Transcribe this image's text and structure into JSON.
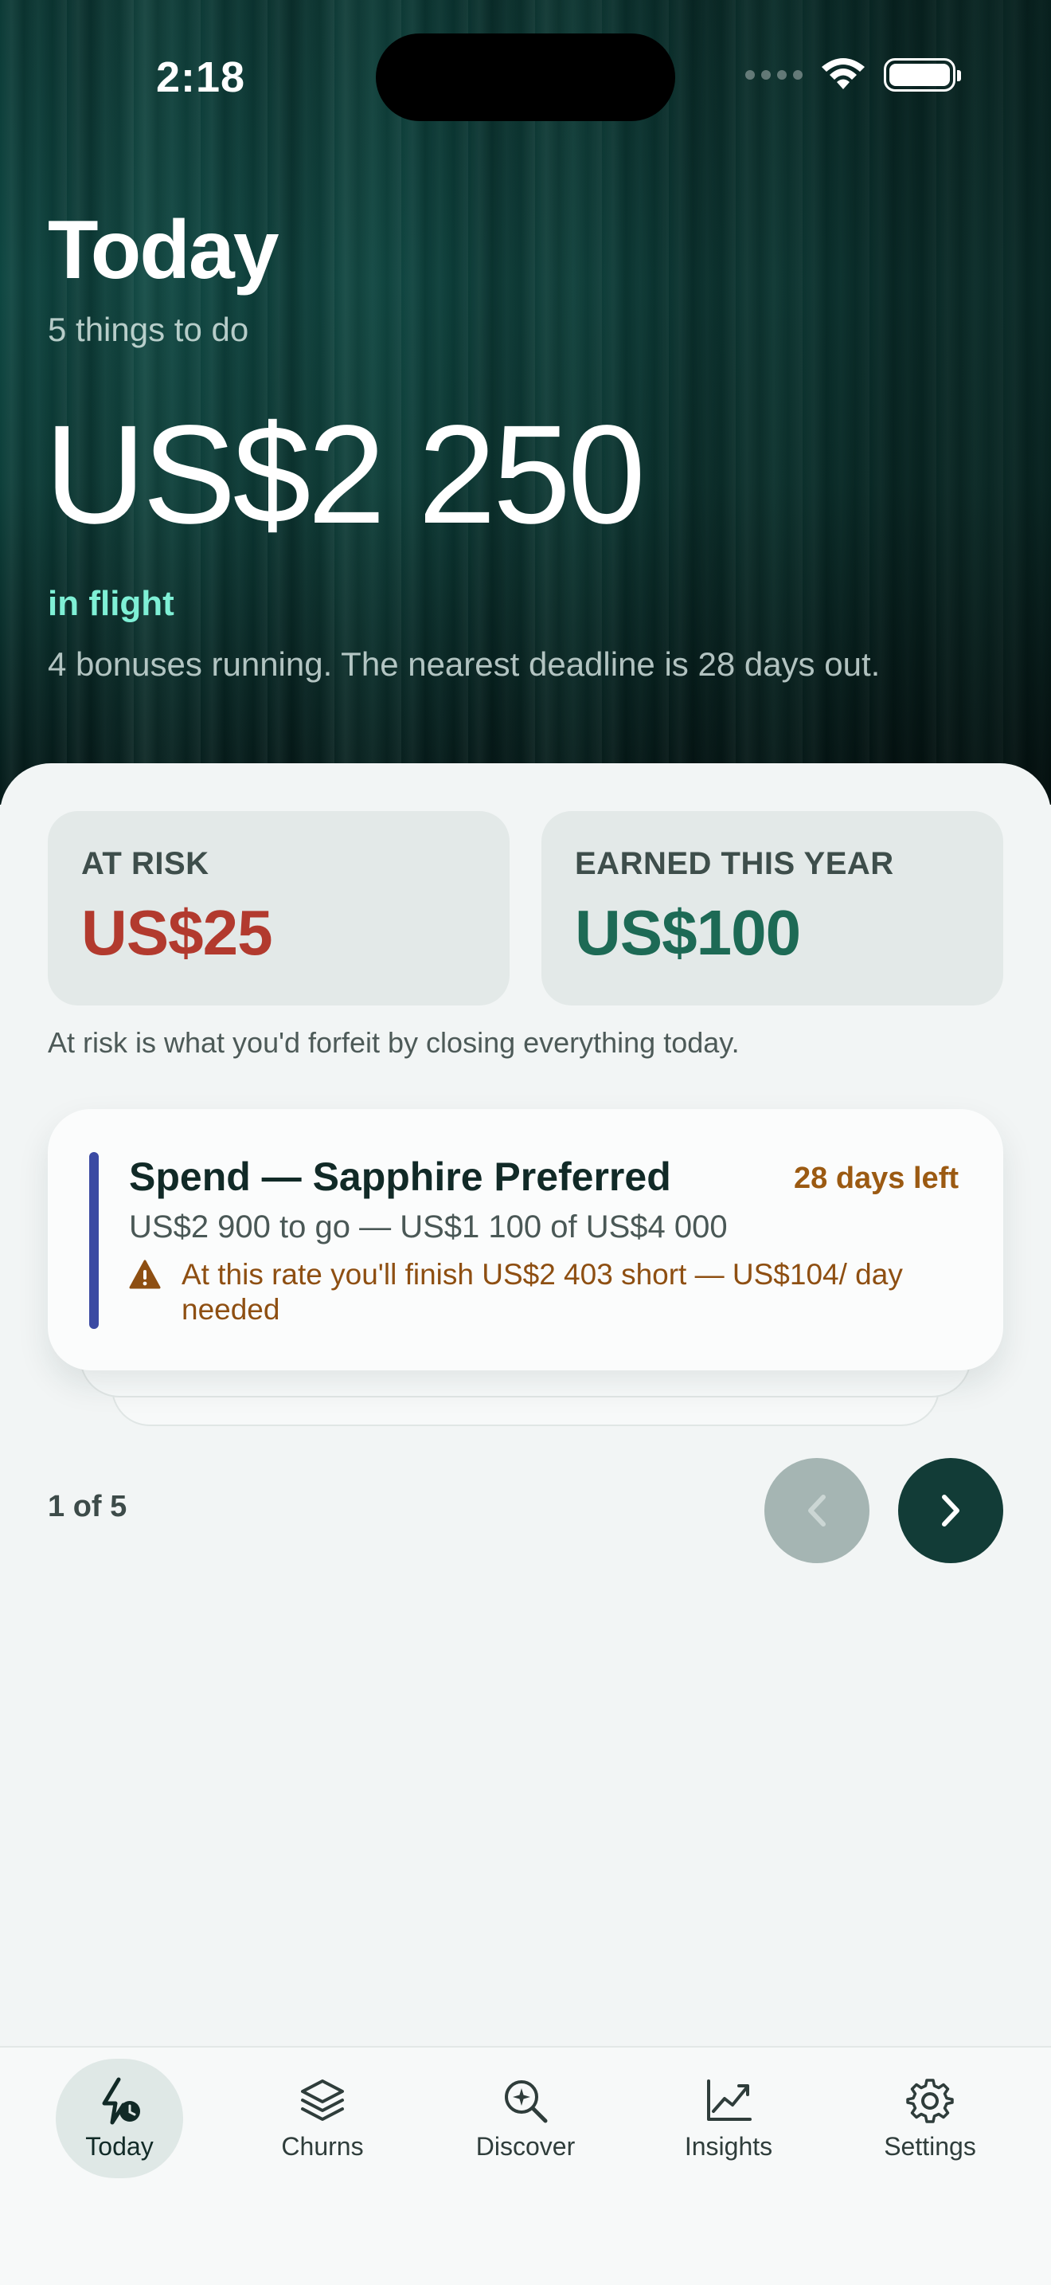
{
  "status_bar": {
    "time": "2:18"
  },
  "hero": {
    "title": "Today",
    "subtitle": "5 things to do",
    "amount": "US$2 250",
    "amount_caption": "in flight",
    "note": "4 bonuses running. The nearest deadline is 28 days out."
  },
  "stats": {
    "at_risk_label": "AT RISK",
    "at_risk_value": "US$25",
    "earned_label": "EARNED THIS YEAR",
    "earned_value": "US$100",
    "note": "At risk is what you'd forfeit by closing everything today."
  },
  "task": {
    "title": "Spend — Sapphire Preferred",
    "days_left": "28 days left",
    "progress": "US$2 900 to go — US$1 100 of US$4 000",
    "warning": "At this rate you'll finish US$2 403 short — US$104/ day needed"
  },
  "pager": {
    "label": "1 of 5"
  },
  "tabs": [
    {
      "label": "Today",
      "icon": "bolt-clock-icon",
      "active": true
    },
    {
      "label": "Churns",
      "icon": "layers-icon",
      "active": false
    },
    {
      "label": "Discover",
      "icon": "search-sparkle-icon",
      "active": false
    },
    {
      "label": "Insights",
      "icon": "chart-line-icon",
      "active": false
    },
    {
      "label": "Settings",
      "icon": "gear-icon",
      "active": false
    }
  ],
  "colors": {
    "hero_bg": "#0d3f3a",
    "accent": "#7ff0d6",
    "risk": "#b23a2e",
    "earned": "#1d6a55",
    "warning": "#9b5a12",
    "task_accent": "#3b4aa3"
  }
}
